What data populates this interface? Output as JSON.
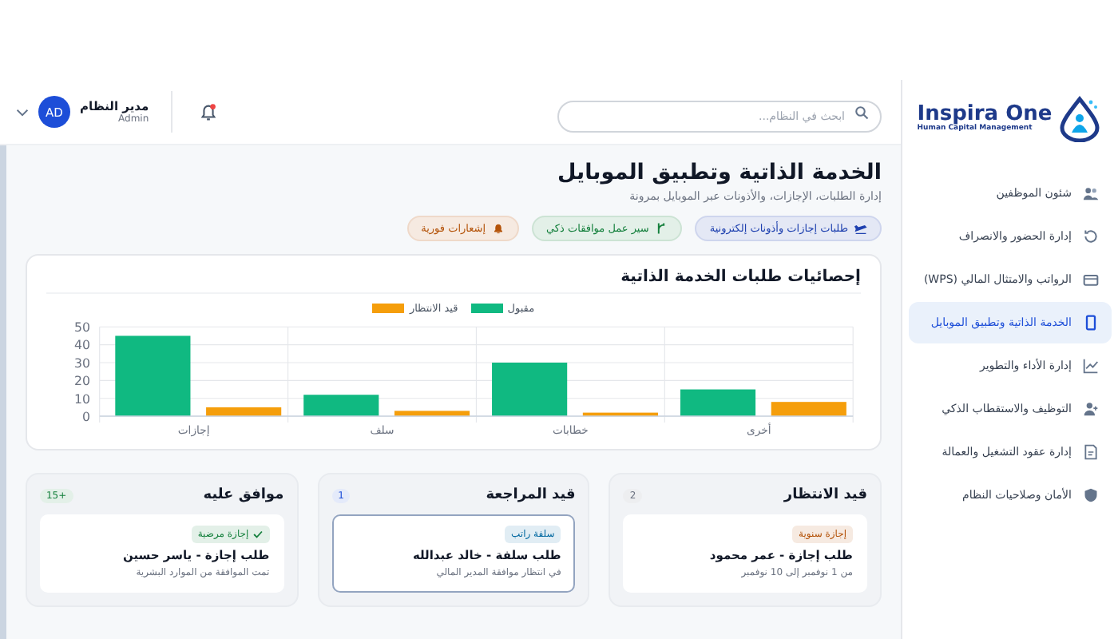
{
  "logo": {
    "name": "Inspira One",
    "tagline": "Human Capital Management"
  },
  "sidebar": {
    "items": [
      {
        "label": "شئون الموظفين",
        "selected": false
      },
      {
        "label": "إدارة الحضور والانصراف",
        "selected": false
      },
      {
        "label": "الرواتب والامتثال المالي (WPS)",
        "selected": false
      },
      {
        "label": "الخدمة الذاتية وتطبيق الموبايل",
        "selected": true
      },
      {
        "label": "إدارة الأداء والتطوير",
        "selected": false
      },
      {
        "label": "التوظيف والاستقطاب الذكي",
        "selected": false
      },
      {
        "label": "إدارة عقود التشغيل والعمالة",
        "selected": false
      },
      {
        "label": "الأمان وصلاحيات النظام",
        "selected": false
      }
    ]
  },
  "header": {
    "search": {
      "placeholder": "ابحث في النظام..."
    },
    "notifications": {
      "unread": true
    },
    "user": {
      "name": "مدير النظام",
      "role": "Admin",
      "initials": "AD"
    }
  },
  "page": {
    "title": "الخدمة الذاتية وتطبيق الموبايل",
    "subtitle": "إدارة الطلبات، الإجازات، والأذونات عبر الموبايل بمرونة",
    "chips": [
      {
        "label": "طلبات إجازات وأذونات إلكترونية",
        "color": "#1e40af"
      },
      {
        "label": "سير عمل موافقات ذكي",
        "color": "#15803d"
      },
      {
        "label": "إشعارات فورية",
        "color": "#b45309"
      }
    ]
  },
  "chart_card": {
    "title": "إحصائيات طلبات الخدمة الذاتية",
    "chart_data": {
      "type": "bar",
      "categories": [
        "إجازات",
        "سلف",
        "خطابات",
        "أخرى"
      ],
      "series": [
        {
          "name": "مقبول",
          "color": "#10b981",
          "values": [
            45,
            12,
            30,
            15
          ]
        },
        {
          "name": "قيد الانتظار",
          "color": "#f59e0b",
          "values": [
            5,
            3,
            2,
            8
          ]
        }
      ],
      "ylim": [
        0,
        50
      ],
      "grid": true,
      "yticks": [
        0,
        10,
        20,
        30,
        40,
        50
      ]
    }
  },
  "board": {
    "columns": [
      {
        "title": "قيد الانتظار",
        "count": "2",
        "color": "#6b7280",
        "cards": [
          {
            "tag": {
              "label": "إجازة سنوية",
              "color": "#b45309",
              "check": false
            },
            "title": "طلب إجازة - عمر محمود",
            "detail": "من 1 نوفمبر إلى 10 نوفمبر",
            "selected": false
          }
        ]
      },
      {
        "title": "قيد المراجعة",
        "count": "1",
        "color": "#1d4ed8",
        "cards": [
          {
            "tag": {
              "label": "سلفة راتب",
              "color": "#0369a1",
              "check": false
            },
            "title": "طلب سلفة - خالد عبدالله",
            "detail": "في انتظار موافقة المدير المالي",
            "selected": true
          }
        ]
      },
      {
        "title": "موافق عليه",
        "count": "+15",
        "color": "#15803d",
        "cards": [
          {
            "tag": {
              "label": "إجازة مرضية",
              "color": "#15803d",
              "check": true
            },
            "title": "طلب إجازة - ياسر حسين",
            "detail": "تمت الموافقة من الموارد البشرية",
            "selected": false
          }
        ]
      }
    ]
  }
}
